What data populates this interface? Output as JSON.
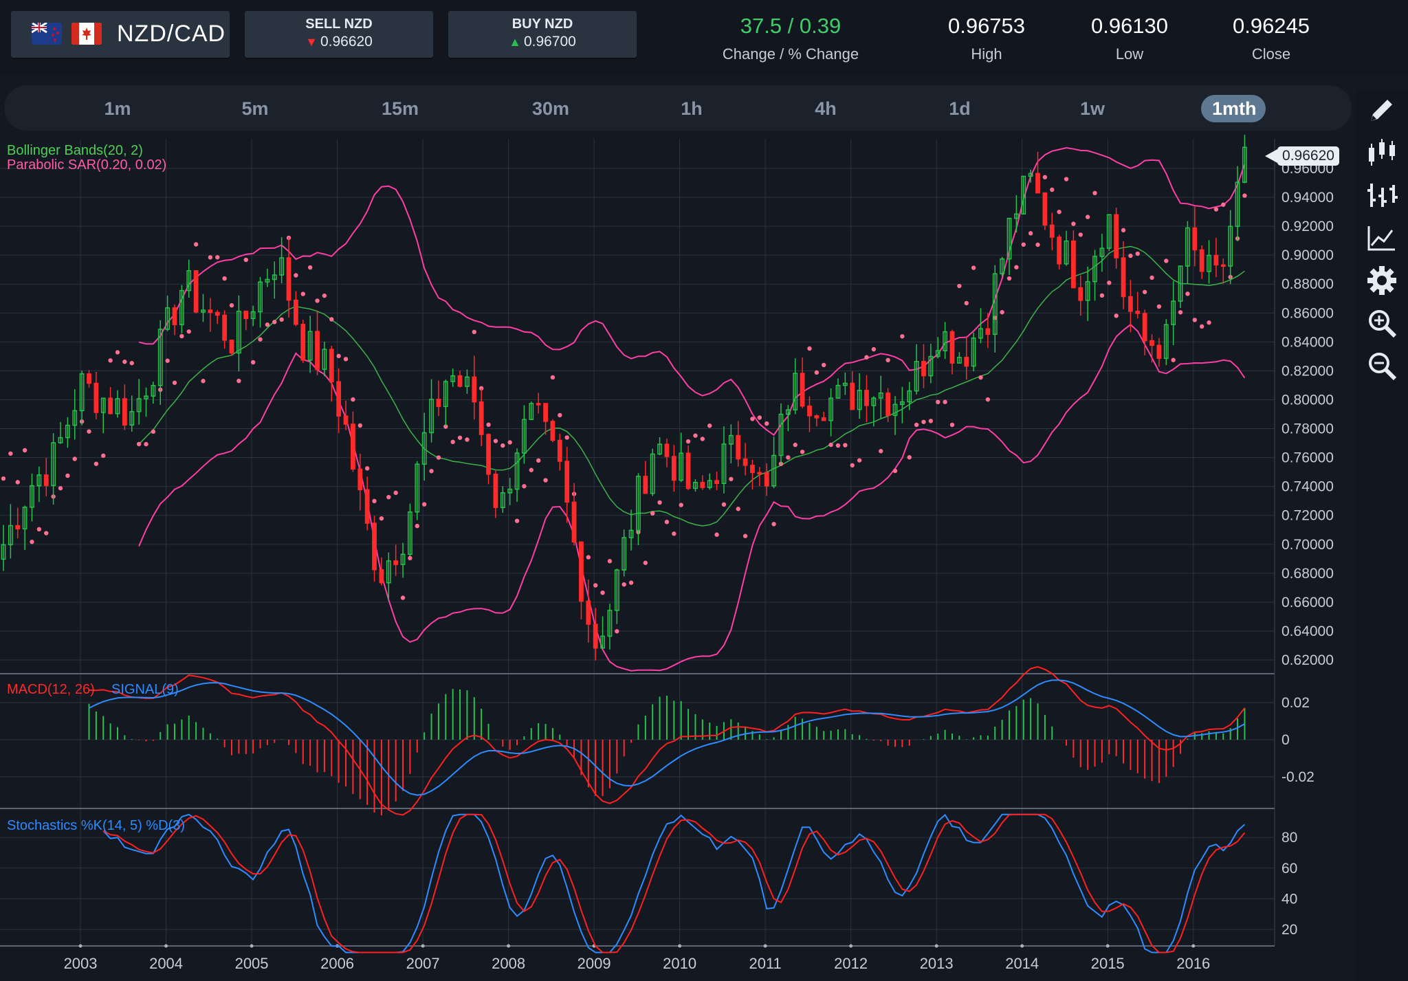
{
  "header": {
    "pair": "NZD/CAD",
    "sell": {
      "label": "SELL NZD",
      "price": "0.96620"
    },
    "buy": {
      "label": "BUY NZD",
      "price": "0.96700"
    },
    "change": {
      "value": "37.5 / 0.39",
      "label": "Change / % Change"
    },
    "high": {
      "value": "0.96753",
      "label": "High"
    },
    "low": {
      "value": "0.96130",
      "label": "Low"
    },
    "close": {
      "value": "0.96245",
      "label": "Close"
    }
  },
  "timeframes": [
    "1m",
    "5m",
    "15m",
    "30m",
    "1h",
    "4h",
    "1d",
    "1w",
    "1mth"
  ],
  "active_timeframe": "1mth",
  "toolbar": [
    "pencil-icon",
    "candlestick-icon",
    "bars-icon",
    "line-chart-icon",
    "gear-icon",
    "zoom-in-icon",
    "zoom-out-icon"
  ],
  "colors": {
    "accent": "#5d7890",
    "up": "#27c24c",
    "down": "#ff2a2a",
    "bollinger": "#ff3fa4",
    "sma": "#3cb34a",
    "sar": "#ff6f91",
    "macd": "#ff2020",
    "signal": "#2f8cff"
  },
  "chart_data": {
    "type": "candlestick",
    "title": "NZD/CAD",
    "current_price": "0.96620",
    "price_axis": {
      "ticks": [
        "0.62000",
        "0.64000",
        "0.66000",
        "0.68000",
        "0.70000",
        "0.72000",
        "0.74000",
        "0.76000",
        "0.78000",
        "0.80000",
        "0.82000",
        "0.84000",
        "0.86000",
        "0.88000",
        "0.90000",
        "0.92000",
        "0.94000",
        "0.96000"
      ],
      "ylim": [
        0.61,
        0.98
      ]
    },
    "x_ticks": [
      "2003",
      "2004",
      "2005",
      "2006",
      "2007",
      "2008",
      "2009",
      "2010",
      "2011",
      "2012",
      "2013",
      "2014",
      "2015",
      "2016"
    ],
    "xlim": [
      2002.06,
      2016.95
    ],
    "indicators": {
      "bollinger": "Bollinger Bands(20, 2)",
      "sar": "Parabolic SAR(0.20, 0.02)",
      "macd": "MACD(12, 26)",
      "signal": "SIGNAL(9)",
      "stochastics": "Stochastics %K(14, 5) %D(3)"
    },
    "close_series": [
      [
        2002.1,
        0.7
      ],
      [
        2002.4,
        0.74
      ],
      [
        2002.7,
        0.76
      ],
      [
        2003.0,
        0.81
      ],
      [
        2003.3,
        0.8
      ],
      [
        2003.6,
        0.79
      ],
      [
        2003.9,
        0.83
      ],
      [
        2004.2,
        0.88
      ],
      [
        2004.5,
        0.86
      ],
      [
        2004.8,
        0.84
      ],
      [
        2005.1,
        0.88
      ],
      [
        2005.3,
        0.9
      ],
      [
        2005.6,
        0.84
      ],
      [
        2005.9,
        0.82
      ],
      [
        2006.1,
        0.78
      ],
      [
        2006.3,
        0.72
      ],
      [
        2006.5,
        0.68
      ],
      [
        2006.8,
        0.71
      ],
      [
        2007.0,
        0.77
      ],
      [
        2007.3,
        0.82
      ],
      [
        2007.6,
        0.8
      ],
      [
        2007.9,
        0.72
      ],
      [
        2008.1,
        0.77
      ],
      [
        2008.3,
        0.79
      ],
      [
        2008.6,
        0.75
      ],
      [
        2008.9,
        0.66
      ],
      [
        2009.0,
        0.63
      ],
      [
        2009.2,
        0.66
      ],
      [
        2009.4,
        0.71
      ],
      [
        2009.7,
        0.77
      ],
      [
        2009.9,
        0.76
      ],
      [
        2010.2,
        0.73
      ],
      [
        2010.5,
        0.76
      ],
      [
        2010.8,
        0.77
      ],
      [
        2011.0,
        0.73
      ],
      [
        2011.3,
        0.81
      ],
      [
        2011.6,
        0.8
      ],
      [
        2011.9,
        0.8
      ],
      [
        2012.2,
        0.81
      ],
      [
        2012.5,
        0.8
      ],
      [
        2012.8,
        0.82
      ],
      [
        2013.0,
        0.85
      ],
      [
        2013.3,
        0.83
      ],
      [
        2013.6,
        0.86
      ],
      [
        2013.9,
        0.93
      ],
      [
        2014.1,
        0.95
      ],
      [
        2014.4,
        0.91
      ],
      [
        2014.7,
        0.88
      ],
      [
        2015.0,
        0.93
      ],
      [
        2015.2,
        0.87
      ],
      [
        2015.4,
        0.84
      ],
      [
        2015.7,
        0.84
      ],
      [
        2015.9,
        0.91
      ],
      [
        2016.1,
        0.89
      ],
      [
        2016.3,
        0.88
      ],
      [
        2016.5,
        0.94
      ],
      [
        2016.6,
        0.966
      ]
    ],
    "macd_axis": {
      "ticks": [
        "0.02",
        "0",
        "-0.02"
      ]
    },
    "stoch_axis": {
      "ticks": [
        "80",
        "60",
        "40",
        "20"
      ]
    }
  }
}
